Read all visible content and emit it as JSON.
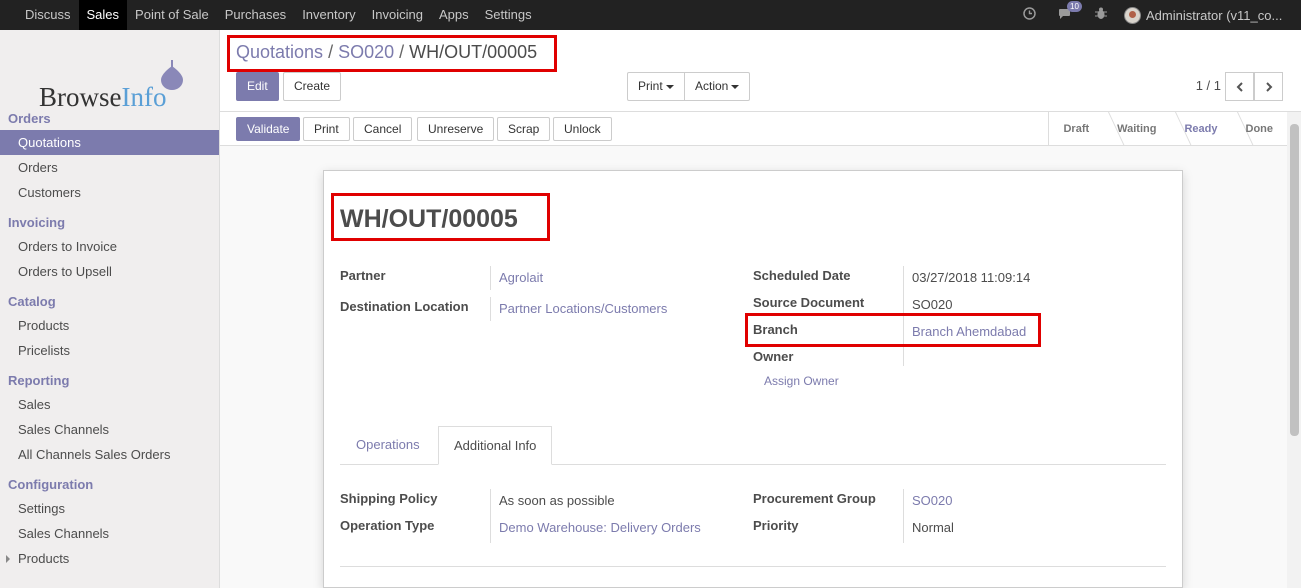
{
  "topbar": {
    "menu": [
      "Discuss",
      "Sales",
      "Point of Sale",
      "Purchases",
      "Inventory",
      "Invoicing",
      "Apps",
      "Settings"
    ],
    "active": "Sales",
    "message_count": "10",
    "user": "Administrator (v11_co..."
  },
  "logo": {
    "part1": "Browse",
    "part2": "Info"
  },
  "sidebar": {
    "orders_title": "Orders",
    "quotations": "Quotations",
    "orders": "Orders",
    "customers": "Customers",
    "invoicing_title": "Invoicing",
    "orders_to_invoice": "Orders to Invoice",
    "orders_to_upsell": "Orders to Upsell",
    "catalog_title": "Catalog",
    "products": "Products",
    "pricelists": "Pricelists",
    "reporting_title": "Reporting",
    "sales": "Sales",
    "sales_channels": "Sales Channels",
    "all_channels": "All Channels Sales Orders",
    "configuration_title": "Configuration",
    "settings": "Settings",
    "conf_sales_channels": "Sales Channels",
    "conf_products": "Products"
  },
  "breadcrumb": {
    "crumb1": "Quotations",
    "crumb2": "SO020",
    "current": "WH/OUT/00005",
    "sep": "/"
  },
  "buttons": {
    "edit": "Edit",
    "create": "Create",
    "print": "Print",
    "action": "Action",
    "pager": "1 / 1"
  },
  "status_buttons": {
    "validate": "Validate",
    "print": "Print",
    "cancel": "Cancel",
    "unreserve": "Unreserve",
    "scrap": "Scrap",
    "unlock": "Unlock"
  },
  "stages": [
    "Draft",
    "Waiting",
    "Ready",
    "Done"
  ],
  "current_stage": "Ready",
  "form": {
    "title": "WH/OUT/00005",
    "partner_label": "Partner",
    "partner": "Agrolait",
    "dest_label": "Destination Location",
    "dest": "Partner Locations/Customers",
    "sched_label": "Scheduled Date",
    "sched": "03/27/2018 11:09:14",
    "source_label": "Source Document",
    "source": "SO020",
    "branch_label": "Branch",
    "branch": "Branch Ahemdabad",
    "owner_label": "Owner",
    "assign_owner": "Assign Owner"
  },
  "tabs": {
    "operations": "Operations",
    "additional": "Additional Info"
  },
  "additional": {
    "ship_label": "Shipping Policy",
    "ship": "As soon as possible",
    "optype_label": "Operation Type",
    "optype": "Demo Warehouse: Delivery Orders",
    "proc_label": "Procurement Group",
    "proc": "SO020",
    "priority_label": "Priority",
    "priority": "Normal"
  },
  "colors": {
    "accent": "#7c7bad",
    "highlight": "#e00000",
    "navbar": "#222222"
  }
}
